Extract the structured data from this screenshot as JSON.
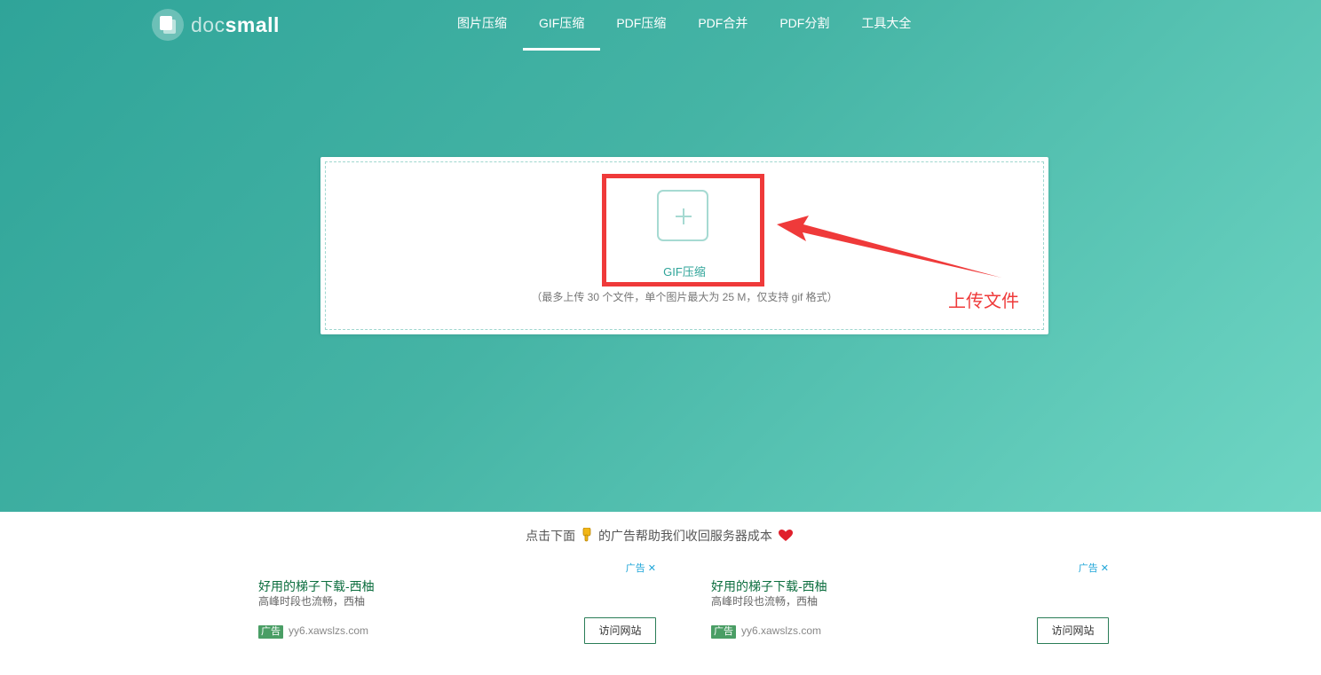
{
  "brand": {
    "prefix": "doc",
    "suffix": "small"
  },
  "nav": {
    "items": [
      {
        "label": "图片压缩",
        "active": false
      },
      {
        "label": "GIF压缩",
        "active": true
      },
      {
        "label": "PDF压缩",
        "active": false
      },
      {
        "label": "PDF合并",
        "active": false
      },
      {
        "label": "PDF分割",
        "active": false
      },
      {
        "label": "工具大全",
        "active": false
      }
    ]
  },
  "upload": {
    "label": "GIF压缩",
    "hint": "（最多上传 30 个文件，单个图片最大为 25 M，仅支持 gif 格式）"
  },
  "annotation": {
    "text": "上传文件",
    "color": "#ef3a3a"
  },
  "ad_notice": {
    "before": "点击下面",
    "after": "的广告帮助我们收回服务器成本"
  },
  "ads": [
    {
      "tag": "广告",
      "title": "好用的梯子下载-西柚",
      "desc": "高峰时段也流畅，西柚",
      "badge": "广告",
      "domain": "yy6.xawslzs.com",
      "button": "访问网站"
    },
    {
      "tag": "广告",
      "title": "好用的梯子下载-西柚",
      "desc": "高峰时段也流畅，西柚",
      "badge": "广告",
      "domain": "yy6.xawslzs.com",
      "button": "访问网站"
    }
  ],
  "colors": {
    "brand_teal": "#2fa499",
    "hero_end": "#6fd6c4",
    "ad_green": "#0d6e3f"
  }
}
